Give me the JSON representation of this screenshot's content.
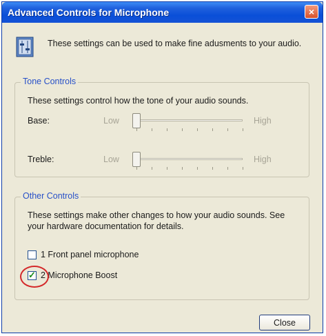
{
  "window": {
    "title": "Advanced Controls for Microphone",
    "close_glyph": "×"
  },
  "intro": {
    "icon": "audio-settings-icon",
    "text": "These settings can be used to make fine adusments to your audio."
  },
  "tone_controls": {
    "label": "Tone Controls",
    "description": "These settings control how the tone of your audio sounds.",
    "bass": {
      "label": "Base:",
      "low": "Low",
      "high": "High",
      "value": 0
    },
    "treble": {
      "label": "Treble:",
      "low": "Low",
      "high": "High",
      "value": 0
    }
  },
  "other_controls": {
    "label": "Other Controls",
    "description": "These settings make other changes to how your audio sounds. See your hardware documentation for details.",
    "options": [
      {
        "label": "1 Front panel microphone",
        "checked": false
      },
      {
        "label": "2 Microphone Boost",
        "checked": true
      }
    ]
  },
  "buttons": {
    "close": "Close"
  }
}
